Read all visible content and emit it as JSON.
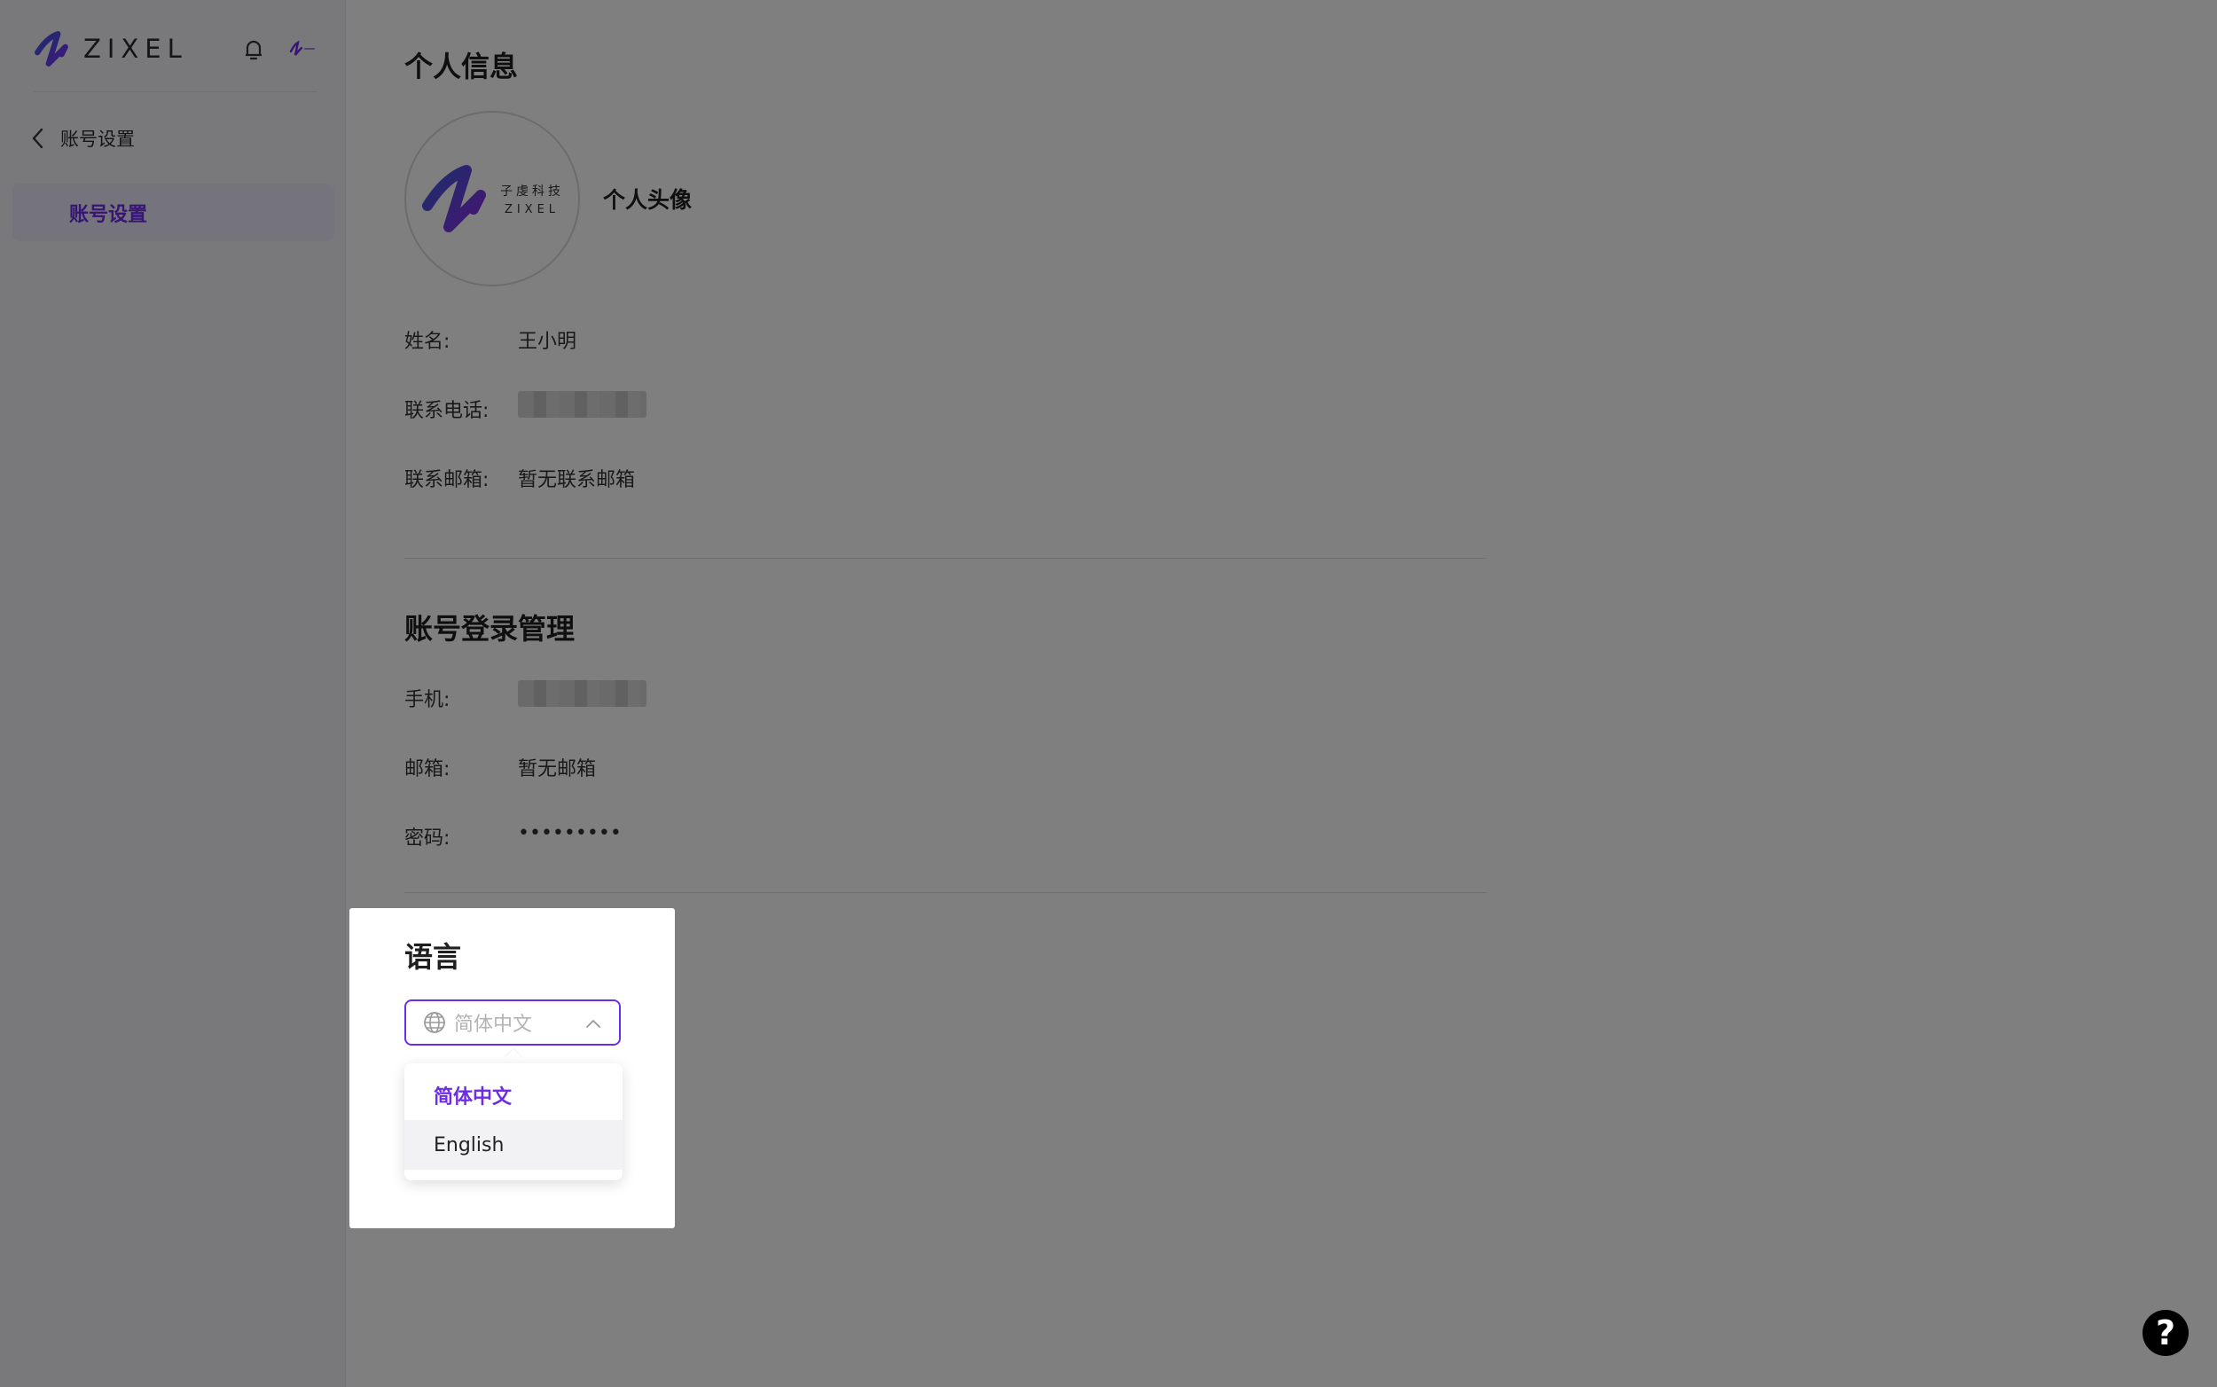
{
  "brand": {
    "name": "ZIXEL",
    "accent": "#6d2ce8"
  },
  "sidebar": {
    "back_label": "账号设置",
    "items": [
      {
        "label": "账号设置",
        "active": true
      }
    ]
  },
  "profile": {
    "section_title": "个人信息",
    "avatar_label": "个人头像",
    "avatar_logo_cn": "子虔科技",
    "avatar_logo_en": "ZIXEL",
    "fields": [
      {
        "label": "姓名:",
        "value": "王小明"
      },
      {
        "label": "联系电话:",
        "value": ""
      },
      {
        "label": "联系邮箱:",
        "value": "暂无联系邮箱"
      }
    ]
  },
  "login": {
    "section_title": "账号登录管理",
    "fields": [
      {
        "label": "手机:",
        "value": ""
      },
      {
        "label": "邮箱:",
        "value": "暂无邮箱"
      },
      {
        "label": "密码:",
        "value": "•••••••••"
      }
    ]
  },
  "language": {
    "section_title": "语言",
    "selected": "简体中文",
    "options": [
      "简体中文",
      "English"
    ],
    "hover_option": "English"
  },
  "help": {
    "label": "?"
  }
}
